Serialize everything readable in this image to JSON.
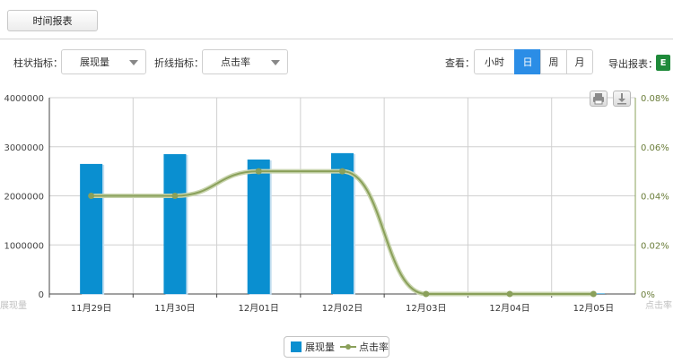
{
  "header": {
    "report_tab_label": "时间报表"
  },
  "toolbar": {
    "bar_metric_label": "柱状指标：",
    "bar_metric_value": "展现量",
    "line_metric_label": "折线指标：",
    "line_metric_value": "点击率",
    "view_label": "查看：",
    "granularity": [
      "小时",
      "日",
      "周",
      "月"
    ],
    "granularity_active": "日",
    "export_label": "导出报表：",
    "export_icon": "excel-icon"
  },
  "colors": {
    "bar": "#0a8fd0",
    "line": "#8aa05a",
    "active_button": "#2b8de6"
  },
  "chart_data": {
    "type": "bar",
    "categories": [
      "11月29日",
      "11月30日",
      "12月01日",
      "12月02日",
      "12月03日",
      "12月04日",
      "12月05日"
    ],
    "series": [
      {
        "name": "展现量",
        "type": "bar",
        "axis": "left",
        "values": [
          2650000,
          2850000,
          2740000,
          2870000,
          0,
          20000,
          10000
        ]
      },
      {
        "name": "点击率",
        "type": "line",
        "axis": "right",
        "values": [
          0.04,
          0.04,
          0.05,
          0.05,
          0,
          0,
          0
        ]
      }
    ],
    "y_left": {
      "label": "展现量",
      "ylim": [
        0,
        4000000
      ],
      "ticks": [
        "0",
        "1000000",
        "2000000",
        "3000000",
        "4000000"
      ]
    },
    "y_right": {
      "label": "点击率",
      "ylim": [
        0,
        0.08
      ],
      "ticks": [
        "0%",
        "0.02%",
        "0.04%",
        "0.06%",
        "0.08%"
      ]
    },
    "grid": true,
    "legend_position": "bottom-center"
  }
}
